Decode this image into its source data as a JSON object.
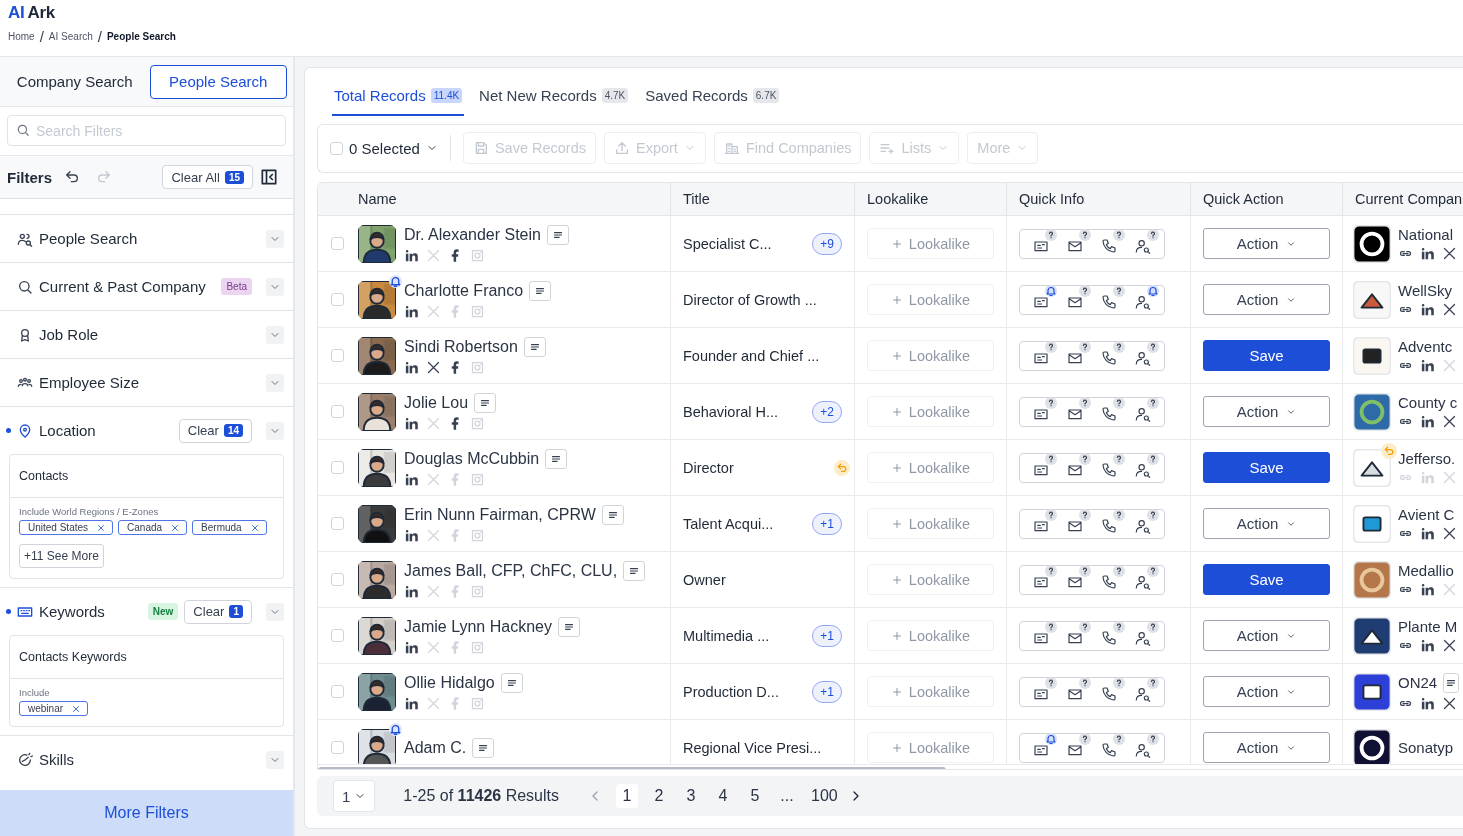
{
  "brand": {
    "accent": "AI",
    "name": "Ark"
  },
  "breadcrumbs": {
    "separator": "/",
    "items": [
      "Home",
      "AI Search",
      "People Search"
    ]
  },
  "mode_tabs": [
    {
      "label": "Company Search",
      "selected": false
    },
    {
      "label": "People Search",
      "selected": true
    }
  ],
  "search": {
    "placeholder": "Search Filters"
  },
  "filters_header": {
    "title": "Filters",
    "clear_label": "Clear All",
    "clear_count": "15"
  },
  "filter_sections": [
    {
      "label": "People Search",
      "active": false
    },
    {
      "label": "Current & Past Company",
      "active": false,
      "badge": {
        "text": "Beta",
        "kind": "beta"
      }
    },
    {
      "label": "Job Role",
      "active": false
    },
    {
      "label": "Employee Size",
      "active": false
    },
    {
      "label": "Location",
      "active": true,
      "clear": {
        "label": "Clear",
        "count": "14"
      },
      "panel": {
        "title": "Contacts",
        "sublabel": "Include World Regions / E-Zones",
        "chips": [
          "United States",
          "Canada",
          "Bermuda"
        ],
        "more": "+11 See More"
      }
    },
    {
      "label": "Keywords",
      "active": true,
      "badge": {
        "text": "New",
        "kind": "new"
      },
      "clear": {
        "label": "Clear",
        "count": "1"
      },
      "panel": {
        "title": "Contacts Keywords",
        "sublabel": "Include",
        "chips": [
          "webinar"
        ]
      }
    },
    {
      "label": "Skills",
      "active": false
    }
  ],
  "more_filters": "More Filters",
  "record_tabs": [
    {
      "label": "Total Records",
      "count": "11.4K",
      "selected": true
    },
    {
      "label": "Net New Records",
      "count": "4.7K",
      "selected": false
    },
    {
      "label": "Saved Records",
      "count": "6.7K",
      "selected": false
    }
  ],
  "toolbar": {
    "select_all": {
      "label": "0 Selected",
      "checked": false
    },
    "buttons": [
      {
        "label": "Save Records",
        "dropdown": false,
        "disabled": true
      },
      {
        "label": "Export",
        "dropdown": true,
        "disabled": true
      },
      {
        "label": "Find Companies",
        "dropdown": false,
        "disabled": true
      },
      {
        "label": "Lists",
        "dropdown": true,
        "disabled": true
      },
      {
        "label": "More",
        "dropdown": true,
        "disabled": true
      }
    ]
  },
  "table": {
    "columns": [
      "Name",
      "Title",
      "Lookalike",
      "Quick Info",
      "Quick Action",
      "Current Compan"
    ],
    "rows": [
      {
        "selected": false,
        "name": "Dr. Alexander Stein",
        "alert": false,
        "social": {
          "x": false,
          "facebook": true
        },
        "title": "Specialist C...",
        "extra": "+9",
        "restored": false,
        "lookalike": "Lookalike",
        "info_alerts": [
          false,
          false,
          false,
          false
        ],
        "action": {
          "kind": "dropdown",
          "label": "Action"
        },
        "company": {
          "name": "National",
          "link": true,
          "linkedin": true,
          "x": true,
          "restored": false,
          "note": false
        }
      },
      {
        "selected": false,
        "name": "Charlotte Franco",
        "alert": true,
        "social": {
          "x": false,
          "facebook": false
        },
        "title": "Director of Growth ...",
        "restored": false,
        "lookalike": "Lookalike",
        "info_alerts": [
          true,
          false,
          false,
          true
        ],
        "action": {
          "kind": "dropdown",
          "label": "Action"
        },
        "company": {
          "name": "WellSky",
          "link": true,
          "linkedin": true,
          "x": true,
          "restored": false,
          "note": false
        }
      },
      {
        "selected": false,
        "name": "Sindi Robertson",
        "alert": false,
        "social": {
          "x": true,
          "facebook": true
        },
        "title": "Founder and Chief ...",
        "restored": false,
        "lookalike": "Lookalike",
        "info_alerts": [
          false,
          false,
          false,
          false
        ],
        "action": {
          "kind": "primary",
          "label": "Save"
        },
        "company": {
          "name": "Adventc",
          "link": true,
          "linkedin": true,
          "x": false,
          "restored": false,
          "note": false
        }
      },
      {
        "selected": false,
        "name": "Jolie Lou",
        "alert": false,
        "social": {
          "x": false,
          "facebook": true
        },
        "title": "Behavioral H...",
        "extra": "+2",
        "restored": false,
        "lookalike": "Lookalike",
        "info_alerts": [
          false,
          false,
          false,
          false
        ],
        "action": {
          "kind": "dropdown",
          "label": "Action"
        },
        "company": {
          "name": "County c",
          "link": true,
          "linkedin": true,
          "x": true,
          "restored": false,
          "note": false
        }
      },
      {
        "selected": false,
        "name": "Douglas McCubbin",
        "alert": false,
        "social": {
          "x": false,
          "facebook": false
        },
        "title": "Director",
        "restored": true,
        "lookalike": "Lookalike",
        "info_alerts": [
          false,
          false,
          false,
          false
        ],
        "action": {
          "kind": "primary",
          "label": "Save"
        },
        "company": {
          "name": "Jefferso.",
          "link": false,
          "linkedin": false,
          "x": false,
          "restored": true,
          "note": false
        }
      },
      {
        "selected": false,
        "name": "Erin Nunn Fairman, CPRW",
        "alert": false,
        "social": {
          "x": false,
          "facebook": false
        },
        "title": "Talent Acqui...",
        "extra": "+1",
        "restored": false,
        "lookalike": "Lookalike",
        "info_alerts": [
          false,
          false,
          false,
          false
        ],
        "action": {
          "kind": "dropdown",
          "label": "Action"
        },
        "company": {
          "name": "Avient C",
          "link": true,
          "linkedin": true,
          "x": true,
          "restored": false,
          "note": false
        }
      },
      {
        "selected": false,
        "name": "James Ball, CFP, ChFC, CLU,",
        "alert": false,
        "social": {
          "x": false,
          "facebook": false
        },
        "title": "Owner",
        "restored": false,
        "lookalike": "Lookalike",
        "info_alerts": [
          false,
          false,
          false,
          false
        ],
        "action": {
          "kind": "primary",
          "label": "Save"
        },
        "company": {
          "name": "Medallio",
          "link": true,
          "linkedin": true,
          "x": false,
          "restored": false,
          "note": false
        }
      },
      {
        "selected": false,
        "name": "Jamie Lynn Hackney",
        "alert": false,
        "social": {
          "x": false,
          "facebook": false
        },
        "title": "Multimedia ...",
        "extra": "+1",
        "restored": false,
        "lookalike": "Lookalike",
        "info_alerts": [
          false,
          false,
          false,
          false
        ],
        "action": {
          "kind": "dropdown",
          "label": "Action"
        },
        "company": {
          "name": "Plante M",
          "link": true,
          "linkedin": true,
          "x": true,
          "restored": false,
          "note": false
        }
      },
      {
        "selected": false,
        "name": "Ollie Hidalgo",
        "alert": false,
        "social": {
          "x": false,
          "facebook": false
        },
        "title": "Production D...",
        "extra": "+1",
        "restored": false,
        "lookalike": "Lookalike",
        "info_alerts": [
          false,
          false,
          false,
          false
        ],
        "action": {
          "kind": "dropdown",
          "label": "Action"
        },
        "company": {
          "name": "ON24",
          "link": true,
          "linkedin": true,
          "x": true,
          "restored": false,
          "note": true
        }
      },
      {
        "selected": false,
        "name": "Adam C.",
        "alert": true,
        "title": "Regional Vice Presi...",
        "restored": false,
        "lookalike": "Lookalike",
        "info_alerts": [
          true,
          false,
          false,
          false
        ],
        "action": {
          "kind": "dropdown",
          "label": "Action"
        },
        "company": {
          "name": "Sonatyp",
          "restored": false,
          "note": false
        }
      }
    ]
  },
  "pagination": {
    "page_size": "1",
    "summary": "1-25 of **11426** Results",
    "pages": [
      {
        "label": "1",
        "selected": true
      },
      {
        "label": "2",
        "selected": false
      },
      {
        "label": "3",
        "selected": false
      },
      {
        "label": "4",
        "selected": false
      },
      {
        "label": "5",
        "selected": false
      },
      {
        "label": "...",
        "selected": false
      },
      {
        "label": "100",
        "selected": false
      }
    ]
  }
}
